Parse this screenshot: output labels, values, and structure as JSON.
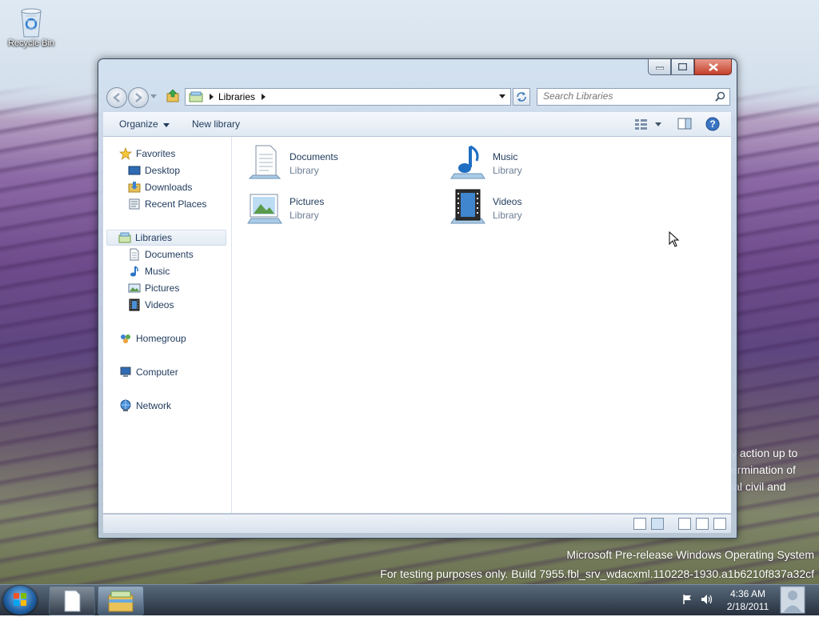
{
  "desktop": {
    "recycle_bin_label": "Recycle Bin",
    "watermark_line1": "Microsoft Pre-release Windows Operating System",
    "watermark_line2": "For testing purposes only. Build 7955.fbl_srv_wdacxml.110228-1930.a1b6210f837a32cf",
    "background_text": [
      "y action up to",
      "ermination of",
      "ial civil and"
    ]
  },
  "window": {
    "address": {
      "path": "Libraries"
    },
    "search": {
      "placeholder": "Search Libraries"
    },
    "toolbar": {
      "organize": "Organize",
      "new_library": "New library"
    },
    "nav_pane": {
      "favorites": {
        "label": "Favorites",
        "items": [
          "Desktop",
          "Downloads",
          "Recent Places"
        ]
      },
      "libraries": {
        "label": "Libraries",
        "items": [
          "Documents",
          "Music",
          "Pictures",
          "Videos"
        ]
      },
      "homegroup": "Homegroup",
      "computer": "Computer",
      "network": "Network"
    },
    "libraries": [
      {
        "name": "Documents",
        "type": "Library",
        "icon": "documents-icon"
      },
      {
        "name": "Music",
        "type": "Library",
        "icon": "music-icon"
      },
      {
        "name": "Pictures",
        "type": "Library",
        "icon": "pictures-icon"
      },
      {
        "name": "Videos",
        "type": "Library",
        "icon": "videos-icon"
      }
    ]
  },
  "taskbar": {
    "time": "4:36 AM",
    "date": "2/18/2011"
  },
  "colors": {
    "link_text": "#1e395b",
    "sub_text": "#6d7e93",
    "close_button": "#c43f2a"
  }
}
